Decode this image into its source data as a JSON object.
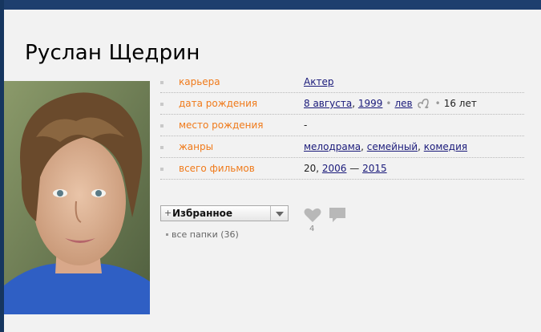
{
  "person": {
    "name": "Руслан Щедрин"
  },
  "info_rows": [
    {
      "label": "карьера",
      "parts": [
        {
          "text": "Актер",
          "link": true
        }
      ]
    },
    {
      "label": "дата рождения",
      "parts": [
        {
          "text": "8 августа",
          "link": true
        },
        {
          "text": ", "
        },
        {
          "text": "1999",
          "link": true
        },
        {
          "sep": "•"
        },
        {
          "text": "лев",
          "link": true,
          "muted": true
        },
        {
          "icon": "leo-zodiac-icon"
        },
        {
          "sep": "•"
        },
        {
          "text": "16 лет"
        }
      ]
    },
    {
      "label": "место рождения",
      "parts": [
        {
          "text": "-"
        }
      ]
    },
    {
      "label": "жанры",
      "parts": [
        {
          "text": "мелодрама",
          "link": true
        },
        {
          "text": ", "
        },
        {
          "text": "семейный",
          "link": true
        },
        {
          "text": ", "
        },
        {
          "text": "комедия",
          "link": true
        }
      ]
    },
    {
      "label": "всего фильмов",
      "parts": [
        {
          "text": "20, "
        },
        {
          "text": "2006",
          "link": true
        },
        {
          "text": " — "
        },
        {
          "text": "2015",
          "link": true
        }
      ]
    }
  ],
  "favorites": {
    "button_label": "Избранное",
    "plus": "+",
    "folders_label": "все папки (36)"
  },
  "likes": {
    "count": "4"
  },
  "colors": {
    "label": "#f07a1a",
    "link": "#1a1a7a",
    "frame": "#1e3f6e",
    "panel": "#f2f2f2"
  }
}
